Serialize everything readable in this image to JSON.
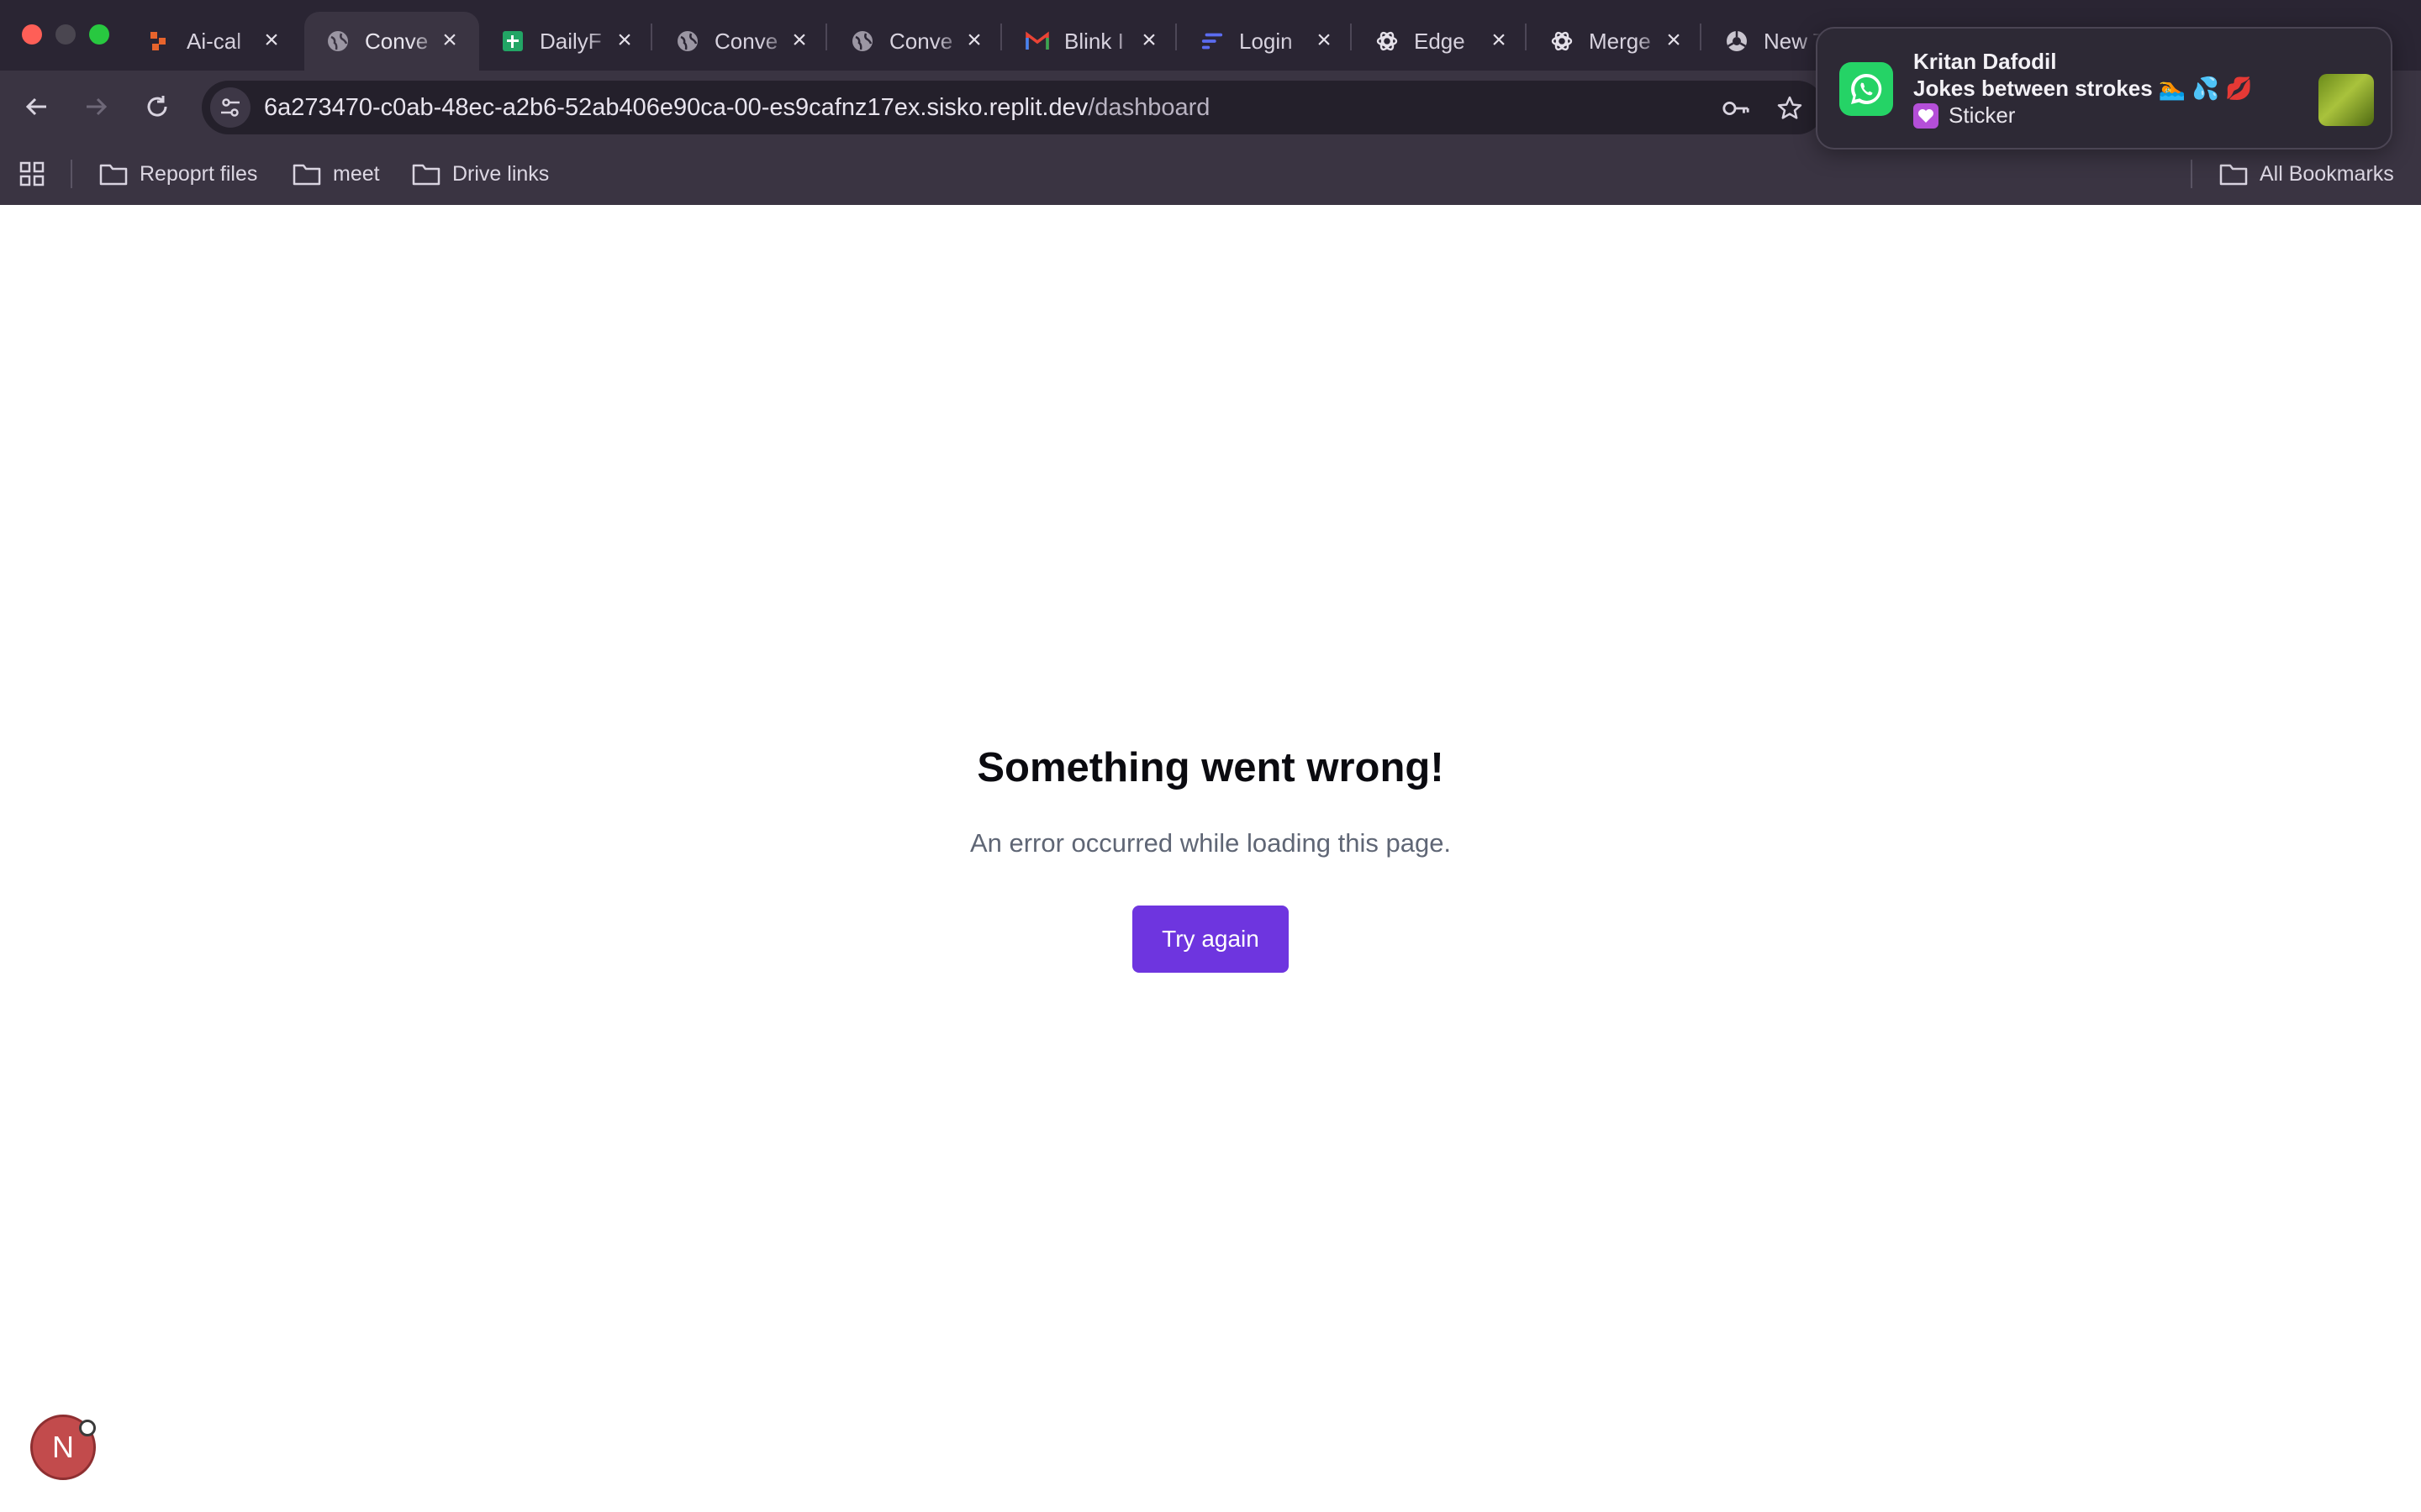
{
  "browser": {
    "tabs": [
      {
        "title": "Ai-cal",
        "icon": "orange-blocks-icon"
      },
      {
        "title": "Conve",
        "icon": "globe-icon",
        "active": true
      },
      {
        "title": "DailyF",
        "icon": "sheets-icon"
      },
      {
        "title": "Conve",
        "icon": "globe-icon"
      },
      {
        "title": "Conve",
        "icon": "globe-icon"
      },
      {
        "title": "Blink I",
        "icon": "gmail-icon"
      },
      {
        "title": "Login",
        "icon": "linear-icon"
      },
      {
        "title": "Edge",
        "icon": "openai-icon"
      },
      {
        "title": "Merge",
        "icon": "openai-icon"
      },
      {
        "title": "New T",
        "icon": "chrome-icon"
      }
    ],
    "url_host": "6a273470-c0ab-48ec-a2b6-52ab406e90ca-00-es9cafnz17ex.sisko.replit.dev",
    "url_path": "/dashboard",
    "bookmarks": [
      {
        "label": "Repoprt files"
      },
      {
        "label": "meet"
      },
      {
        "label": "Drive links"
      }
    ],
    "all_bookmarks_label": "All Bookmarks"
  },
  "page": {
    "error_title": "Something went wrong!",
    "error_message": "An error occurred while loading this page.",
    "retry_label": "Try again",
    "dev_badge_letter": "N"
  },
  "notification": {
    "app_icon": "whatsapp-icon",
    "sender": "Kritan Dafodil",
    "message": "Jokes between strokes 🏊 💦 💋",
    "attachment_label": "Sticker",
    "attachment_icon": "heart-icon"
  },
  "colors": {
    "chrome_dark": "#2a2533",
    "chrome_toolbar": "#3a3442",
    "button_primary": "#6e35df",
    "whatsapp_green": "#25d366"
  }
}
